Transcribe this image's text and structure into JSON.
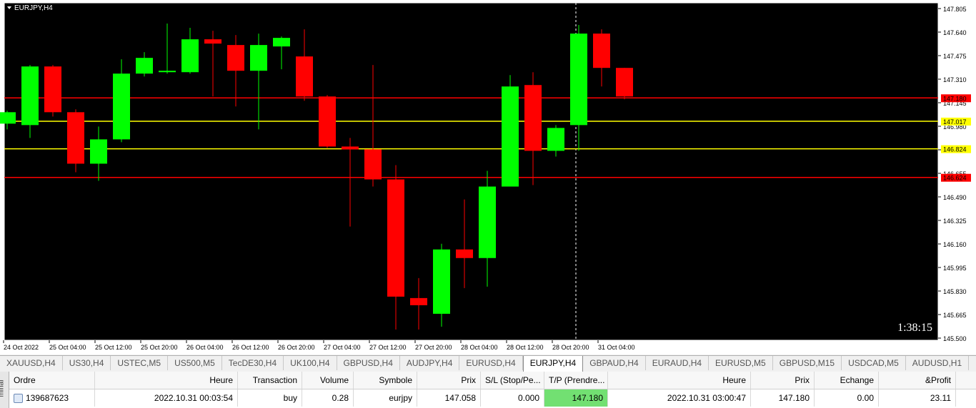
{
  "window": {
    "title": "EURJPY,H4"
  },
  "chart": {
    "timer": "1:38:15",
    "price_labels": [
      "147.805",
      "147.640",
      "147.475",
      "147.310",
      "147.145",
      "146.980",
      "146.815",
      "146.655",
      "146.490",
      "146.325",
      "146.160",
      "145.995",
      "145.830",
      "145.665",
      "145.500"
    ],
    "time_labels": [
      "24 Oct 2022",
      "25 Oct 04:00",
      "25 Oct 12:00",
      "25 Oct 20:00",
      "26 Oct 04:00",
      "26 Oct 12:00",
      "26 Oct 20:00",
      "27 Oct 04:00",
      "27 Oct 12:00",
      "27 Oct 20:00",
      "28 Oct 04:00",
      "28 Oct 12:00",
      "28 Oct 20:00",
      "31 Oct 04:00"
    ],
    "colors": {
      "bull": "#00ff00",
      "bear": "#ff0000",
      "background": "#000000",
      "grid": "#ffffff",
      "hline_red": "#ff0000",
      "hline_yellow": "#ffff00"
    },
    "hlines": [
      {
        "price": 147.18,
        "label": "147.180",
        "color": "#ff0000"
      },
      {
        "price": 147.017,
        "label": "147.017",
        "color": "#ffff00"
      },
      {
        "price": 146.824,
        "label": "146.824",
        "color": "#ffff00"
      },
      {
        "price": 146.624,
        "label": "146.624",
        "color": "#ff0000"
      }
    ],
    "candles": [
      {
        "o": 147.0,
        "h": 147.09,
        "l": 146.96,
        "c": 147.08
      },
      {
        "o": 146.99,
        "h": 147.41,
        "l": 146.9,
        "c": 147.4
      },
      {
        "o": 147.4,
        "h": 147.41,
        "l": 147.05,
        "c": 147.08
      },
      {
        "o": 147.08,
        "h": 147.1,
        "l": 146.66,
        "c": 146.72
      },
      {
        "o": 146.72,
        "h": 146.98,
        "l": 146.6,
        "c": 146.89
      },
      {
        "o": 146.89,
        "h": 147.45,
        "l": 146.87,
        "c": 147.35
      },
      {
        "o": 147.35,
        "h": 147.5,
        "l": 147.33,
        "c": 147.46
      },
      {
        "o": 147.36,
        "h": 147.7,
        "l": 147.35,
        "c": 147.37
      },
      {
        "o": 147.36,
        "h": 147.67,
        "l": 147.35,
        "c": 147.59
      },
      {
        "o": 147.59,
        "h": 147.65,
        "l": 147.19,
        "c": 147.56
      },
      {
        "o": 147.55,
        "h": 147.62,
        "l": 147.12,
        "c": 147.37
      },
      {
        "o": 147.37,
        "h": 147.63,
        "l": 146.96,
        "c": 147.55
      },
      {
        "o": 147.54,
        "h": 147.61,
        "l": 147.38,
        "c": 147.6
      },
      {
        "o": 147.47,
        "h": 147.66,
        "l": 147.16,
        "c": 147.19
      },
      {
        "o": 147.19,
        "h": 147.2,
        "l": 146.83,
        "c": 146.84
      },
      {
        "o": 146.84,
        "h": 146.9,
        "l": 146.28,
        "c": 146.82
      },
      {
        "o": 146.82,
        "h": 147.41,
        "l": 146.56,
        "c": 146.61
      },
      {
        "o": 146.61,
        "h": 146.71,
        "l": 145.56,
        "c": 145.79
      },
      {
        "o": 145.78,
        "h": 145.92,
        "l": 145.56,
        "c": 145.73
      },
      {
        "o": 145.67,
        "h": 146.16,
        "l": 145.58,
        "c": 146.12
      },
      {
        "o": 146.12,
        "h": 146.47,
        "l": 145.85,
        "c": 146.06
      },
      {
        "o": 146.06,
        "h": 146.67,
        "l": 145.86,
        "c": 146.56
      },
      {
        "o": 146.56,
        "h": 147.34,
        "l": 146.56,
        "c": 147.26
      },
      {
        "o": 147.27,
        "h": 147.36,
        "l": 146.57,
        "c": 146.81
      },
      {
        "o": 146.81,
        "h": 146.99,
        "l": 146.77,
        "c": 146.97
      },
      {
        "o": 146.99,
        "h": 147.69,
        "l": 146.81,
        "c": 147.63
      },
      {
        "o": 147.63,
        "h": 147.66,
        "l": 147.26,
        "c": 147.39
      },
      {
        "o": 147.39,
        "h": 147.39,
        "l": 147.17,
        "c": 147.19
      }
    ]
  },
  "tabs": [
    "XAUUSD,H4",
    "US30,H4",
    "USTEC,M5",
    "US500,M5",
    "TecDE30,H4",
    "UK100,H4",
    "GBPUSD,H4",
    "AUDJPY,H4",
    "EURUSD,H4",
    "EURJPY,H4",
    "GBPAUD,H4",
    "EURAUD,H4",
    "EURUSD,M5",
    "GBPUSD,M15",
    "USDCAD,M5",
    "AUDUSD,H1"
  ],
  "active_tab": "EURJPY,H4",
  "terminal": {
    "side_label": "minal",
    "headers": [
      "Ordre",
      "Heure",
      "Transaction",
      "Volume",
      "Symbole",
      "Prix",
      "S/L (Stop/Pe...",
      "T/P (Prendre...",
      "Heure",
      "Prix",
      "Echange",
      "&Profit"
    ],
    "row": {
      "ordre": "139687623",
      "heure": "2022.10.31 00:03:54",
      "transaction": "buy",
      "volume": "0.28",
      "symbole": "eurjpy",
      "prix": "147.058",
      "sl": "0.000",
      "tp": "147.180",
      "heure2": "2022.10.31 03:00:47",
      "prix2": "147.180",
      "echange": "0.00",
      "profit": "23.11"
    }
  }
}
